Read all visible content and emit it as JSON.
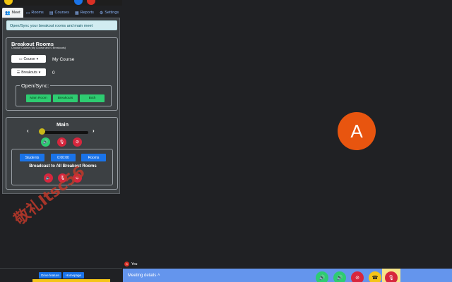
{
  "tabs": [
    {
      "label": "Meet",
      "icon": "users-icon"
    },
    {
      "label": "Rooms",
      "icon": "monitor-icon"
    },
    {
      "label": "Courses",
      "icon": "folder-icon"
    },
    {
      "label": "Reports",
      "icon": "document-icon"
    },
    {
      "label": "Settings",
      "icon": "gear-icon"
    }
  ],
  "info_text": "Open/Sync your breakout rooms and main meet",
  "breakout": {
    "title": "Breakout Rooms",
    "subtitle": "Choose Course (My Course and 0 Breakouts)",
    "course_button": "Course",
    "course_name": "My Course",
    "breakouts_button": "Breakouts",
    "breakouts_count": "0",
    "open_sync_legend": "Open/Sync:",
    "buttons": [
      "Main Room",
      "Breakouts",
      "Both"
    ]
  },
  "main": {
    "title": "Main",
    "slider_level": 0,
    "buttons": {
      "students": "Students",
      "timer": "0:00:00",
      "rooms": "Rooms"
    },
    "broadcast": "Broadcast to All Breakout Rooms"
  },
  "footer": {
    "buttons": [
      "Drive feature",
      "Homepage"
    ]
  },
  "watermark": "敬礼Itsc56",
  "participant": {
    "avatar_letter": "A",
    "you_label": "You",
    "you_initial": "S"
  },
  "meeting": {
    "details_label": "Meeting details"
  },
  "colors": {
    "accent": "#1a73e8",
    "green": "#2ecc71",
    "red": "#d7263d",
    "avatar": "#e8550f",
    "bar": "#6495ed"
  }
}
